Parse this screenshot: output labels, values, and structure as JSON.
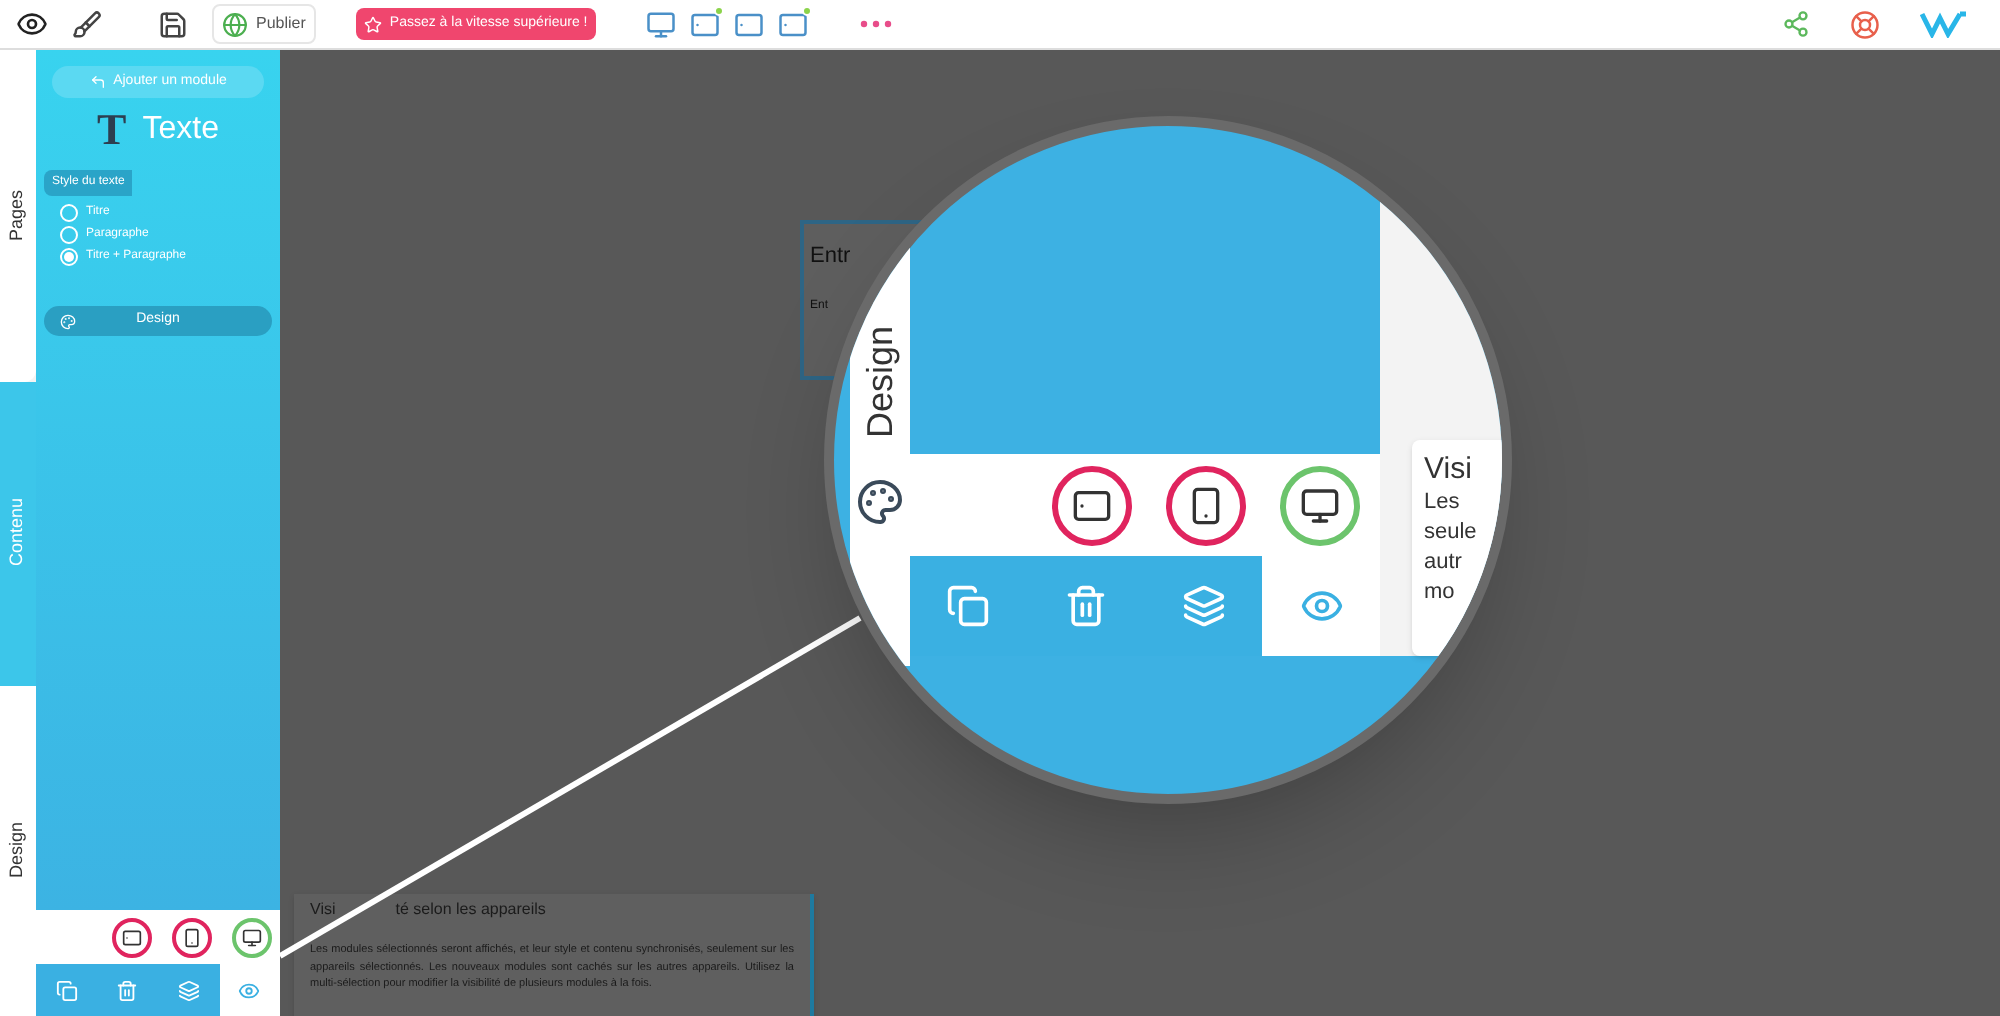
{
  "toolbar": {
    "publish_label": "Publier",
    "upgrade_label": "Passez à la vitesse supérieure !",
    "preview_devices": [
      {
        "kind": "desktop",
        "synced": false
      },
      {
        "kind": "tablet",
        "synced": true
      },
      {
        "kind": "landscape",
        "synced": false
      },
      {
        "kind": "tablet",
        "synced": true
      }
    ]
  },
  "side_tabs": [
    {
      "label": "Pages",
      "selected": false
    },
    {
      "label": "Contenu",
      "selected": true
    },
    {
      "label": "Design",
      "selected": false
    }
  ],
  "panel": {
    "add_module": "Ajouter un module",
    "module_letter": "T",
    "module_title": "Texte",
    "style_heading": "Style du texte",
    "style_options": [
      {
        "label": "Titre",
        "selected": false
      },
      {
        "label": "Paragraphe",
        "selected": false
      },
      {
        "label": "Titre + Paragraphe",
        "selected": true
      }
    ],
    "design_button": "Design"
  },
  "device_visibility": [
    {
      "kind": "tablet",
      "visible": false
    },
    {
      "kind": "mobile",
      "visible": false
    },
    {
      "kind": "desktop",
      "visible": true
    }
  ],
  "actions": [
    {
      "kind": "duplicate",
      "selected": false
    },
    {
      "kind": "delete",
      "selected": false
    },
    {
      "kind": "layers",
      "selected": false
    },
    {
      "kind": "visibility",
      "selected": true
    }
  ],
  "canvas_module": {
    "title": "Entr",
    "text": "Ent"
  },
  "tooltip": {
    "title_parts": [
      "Visi",
      "té selon les appareils"
    ],
    "body": "Les modules sélectionnés seront affichés, et leur style et contenu synchronisés, seulement sur les appareils sélectionnés. Les nouveaux modules sont cachés sur les autres appareils. Utilisez la multi-sélection pour modifier la visibilité de plusieurs modules à la fois."
  },
  "magnifier": {
    "tab_label": "Design",
    "devices": [
      {
        "kind": "tablet",
        "visible": false
      },
      {
        "kind": "mobile",
        "visible": false
      },
      {
        "kind": "desktop",
        "visible": true
      }
    ],
    "actions": [
      {
        "kind": "duplicate",
        "selected": false
      },
      {
        "kind": "delete",
        "selected": false
      },
      {
        "kind": "layers",
        "selected": false
      },
      {
        "kind": "visibility",
        "selected": true
      }
    ],
    "tooltip_title": "Visi",
    "tooltip_lines": [
      "Les",
      "seule",
      "autr",
      "mo"
    ]
  }
}
